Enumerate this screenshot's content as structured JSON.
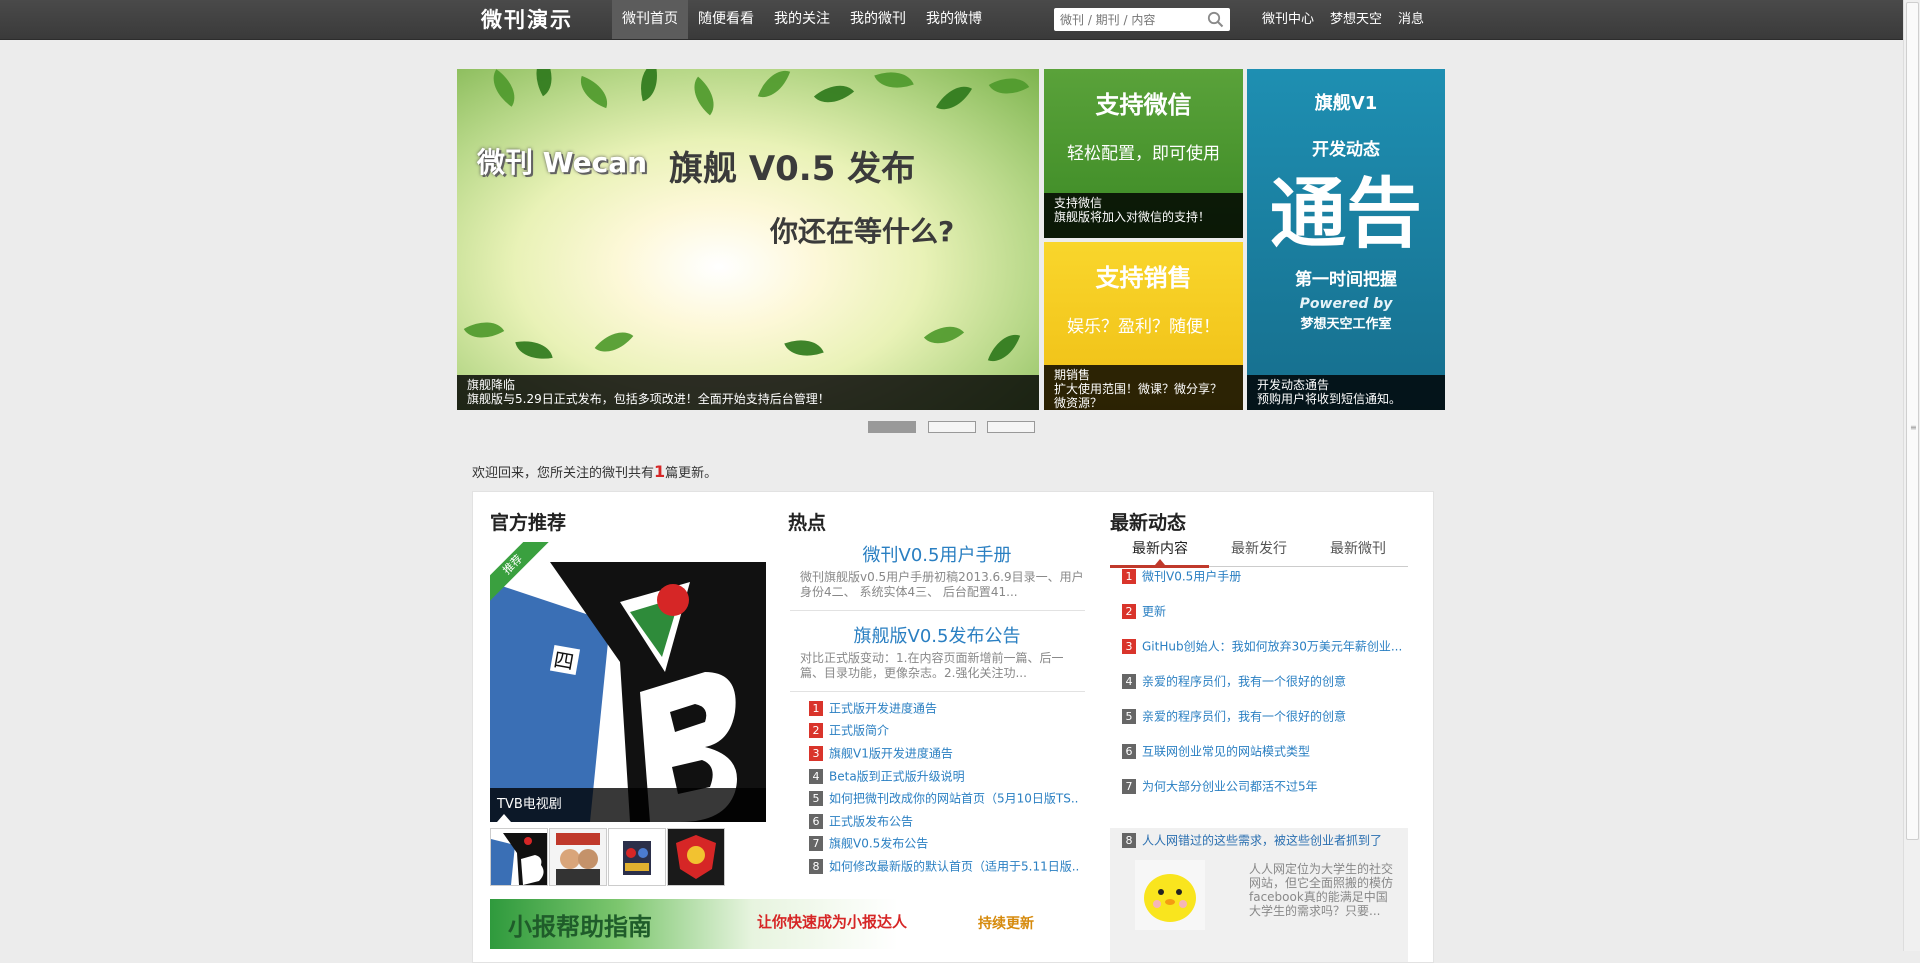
{
  "header": {
    "logo": "微刊演示",
    "nav": [
      "微刊首页",
      "随便看看",
      "我的关注",
      "我的微刊",
      "我的微博"
    ],
    "search_placeholder": "微刊 / 期刊 / 内容",
    "links": [
      "微刊中心",
      "梦想天空",
      "消息"
    ]
  },
  "banner": {
    "main": {
      "brand": "微刊 Wecan",
      "headline": "旗舰 V0.5 发布",
      "subline": "你还在等什么?",
      "caption_title": "旗舰降临",
      "caption_text": "旗舰版与5.29日正式发布，包括多项改进！全面开始支持后台管理！"
    },
    "wechat": {
      "title": "支持微信",
      "subtitle": "轻松配置，即可使用",
      "caption_title": "支持微信",
      "caption_text": "旗舰版将加入对微信的支持！"
    },
    "sales": {
      "title": "支持销售",
      "subtitle": "娱乐？盈利？随便！",
      "caption_title": "期销售",
      "caption_text": "扩大使用范围！微课？微分享？微资源？"
    },
    "notice": {
      "line1": "旗舰V1",
      "line2": "开发动态",
      "big": "通告",
      "line3": "第一时间把握",
      "powered": "Powered by",
      "studio": "梦想天空工作室",
      "caption_title": "开发动态通告",
      "caption_text": "预购用户将收到短信通知。"
    }
  },
  "welcome": {
    "before": "欢迎回来，您所关注的微刊共有",
    "count": "1",
    "after": "篇更新。"
  },
  "official": {
    "title": "官方推荐",
    "badge": "推荐",
    "caption": "TVB电视剧"
  },
  "hot": {
    "title": "热点",
    "featured": [
      {
        "title": "微刊V0.5用户手册",
        "desc": "微刊旗舰版v0.5用户手册初稿2013.6.9目录一、用户身份4二、 系统实体4三、 后台配置41..."
      },
      {
        "title": "旗舰版V0.5发布公告",
        "desc": "对比正式版变动：1.在内容页面新增前一篇、后一篇、目录功能，更像杂志。2.强化关注功..."
      }
    ],
    "list": [
      "正式版开发进度通告",
      "正式版简介",
      "旗舰V1版开发进度通告",
      "Beta版到正式版升级说明",
      "如何把微刊改成你的网站首页（5月10日版TS...",
      "正式版发布公告",
      "旗舰V0.5发布公告",
      "如何修改最新版的默认首页（适用于5.11日版..."
    ]
  },
  "latest": {
    "title": "最新动态",
    "tabs": [
      "最新内容",
      "最新发行",
      "最新微刊"
    ],
    "list": [
      "微刊V0.5用户手册",
      "更新",
      "GitHub创始人：我如何放弃30万美元年薪创业...",
      "亲爱的程序员们，我有一个很好的创意",
      "亲爱的程序员们，我有一个很好的创意",
      "互联网创业常见的网站模式类型",
      "为何大部分创业公司都活不过5年",
      "人人网错过的这些需求，被这些创业者抓到了"
    ],
    "expanded_desc": "人人网定位为大学生的社交网站，但它全面照搬的模仿facebook真的能满足中国大学生的需求吗？只要..."
  },
  "guide": {
    "title": "小报帮助指南",
    "slogan": "让你快速成为小报达人",
    "note": "持续更新"
  }
}
